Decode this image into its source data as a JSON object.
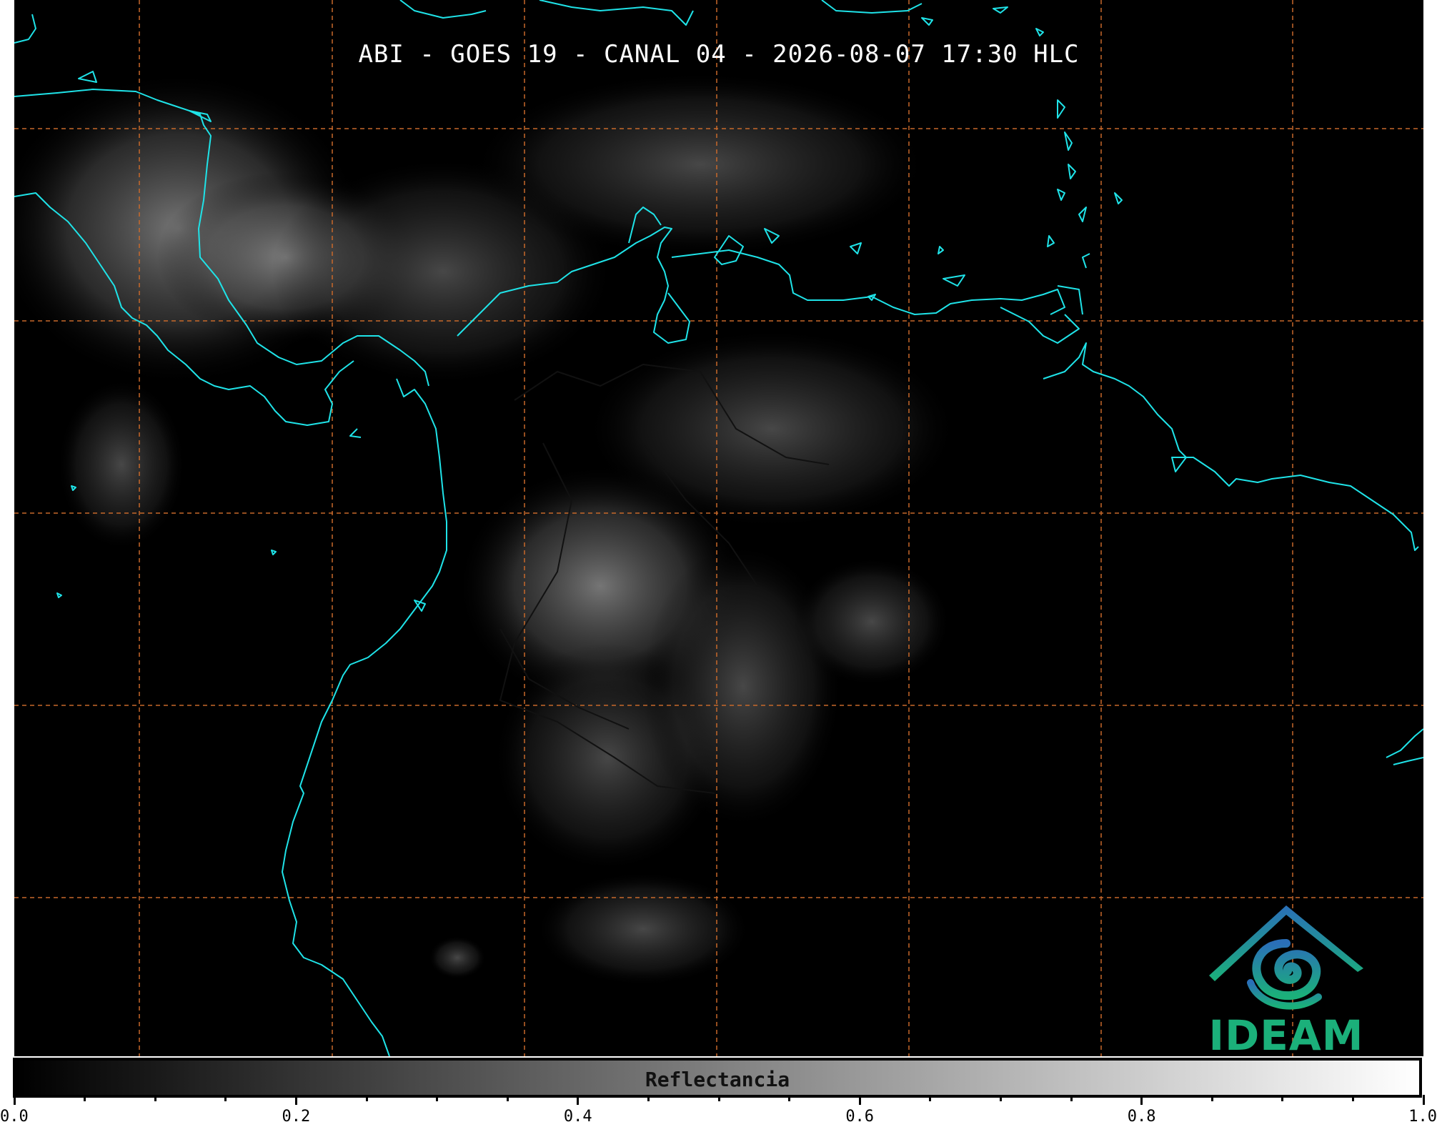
{
  "title": "ABI - GOES 19 - CANAL 04 - 2026-08-07 17:30 HLC",
  "colorbar": {
    "label": "Reflectancia",
    "range": [
      0.0,
      1.0
    ],
    "ticks": [
      "0.0",
      "0.2",
      "0.4",
      "0.6",
      "0.8",
      "1.0"
    ]
  },
  "logo": {
    "text": "IDEAM"
  },
  "colors": {
    "background": "#000000",
    "coastline": "#1fe3e8",
    "gridline": "#c8692a",
    "borders": "#111111",
    "logo_blue": "#2a6fb8",
    "logo_green": "#1bb07a"
  }
}
